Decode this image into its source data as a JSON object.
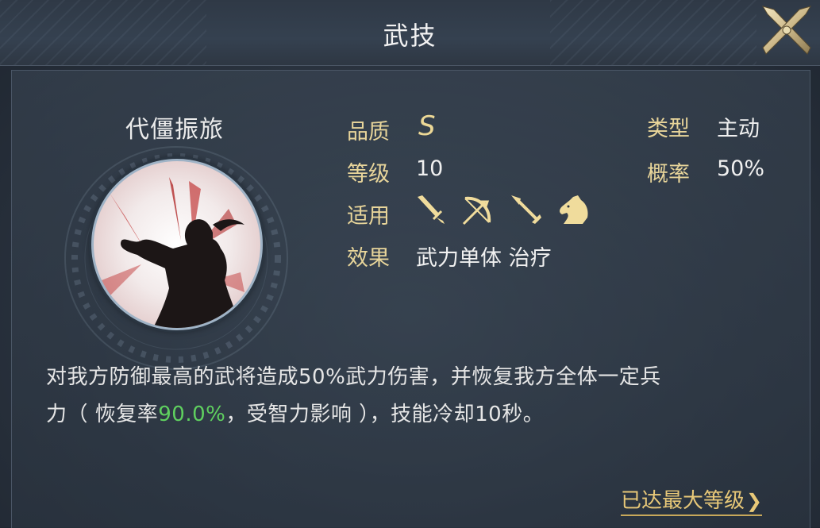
{
  "header": {
    "title": "武技"
  },
  "skill": {
    "name": "代僵振旅",
    "quality_label": "品质",
    "quality_value": "S",
    "level_label": "等级",
    "level_value": "10",
    "applies_label": "适用",
    "applies_icons": [
      "sword-icon",
      "bow-icon",
      "spear-icon",
      "horse-icon"
    ],
    "effect_label": "效果",
    "effect_value": "武力单体 治疗",
    "type_label": "类型",
    "type_value": "主动",
    "chance_label": "概率",
    "chance_value": "50%"
  },
  "description": {
    "line1": "对我方防御最高的武将造成50%武力伤害，并恢复我方全体一定兵",
    "line2_pre": "力（ 恢复率",
    "line2_highlight": "90.0%",
    "line2_post": "，受智力影响 ），技能冷却10秒。"
  },
  "footer": {
    "max_level_label": "已达最大等级",
    "arrow": "❯"
  },
  "colors": {
    "label": "#e8d59a",
    "highlight": "#5fd05f",
    "link": "#e8c878"
  }
}
